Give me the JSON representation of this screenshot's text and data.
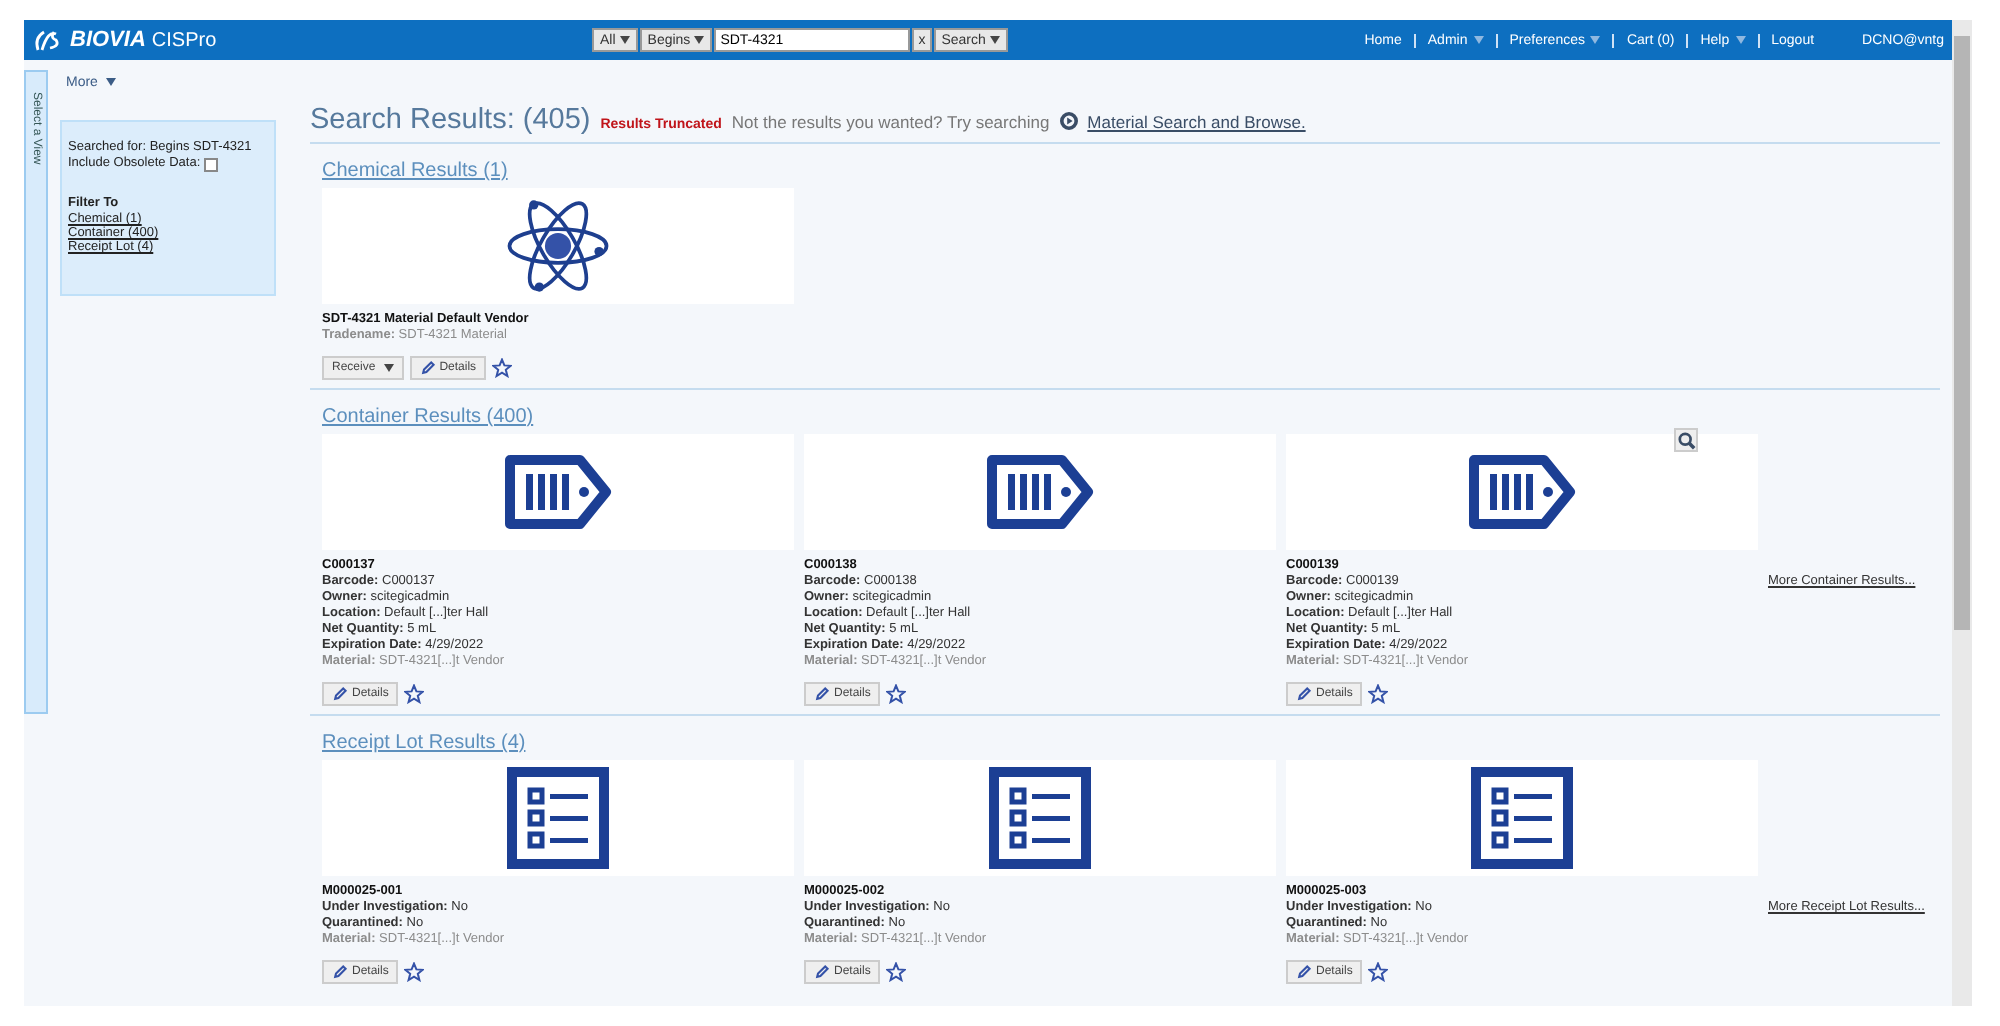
{
  "header": {
    "brand": "BIOVIA",
    "product": "CISPro",
    "search": {
      "scope": "All",
      "mode": "Begins",
      "value": "SDT-4321",
      "clear": "x",
      "button": "Search"
    },
    "nav": [
      {
        "label": "Home",
        "dropdown": false
      },
      {
        "label": "Admin",
        "dropdown": true
      },
      {
        "label": "Preferences",
        "dropdown": true
      },
      {
        "label": "Cart (0)",
        "dropdown": false
      },
      {
        "label": "Help",
        "dropdown": true
      },
      {
        "label": "Logout",
        "dropdown": false
      }
    ],
    "user": "DCNO@vntg"
  },
  "more_menu": "More",
  "side_tab": "Select a View",
  "filter_panel": {
    "searched_for": "Searched for: Begins SDT-4321",
    "include_obsolete": {
      "label": "Include Obsolete Data:",
      "checked": false
    },
    "filter_title": "Filter To",
    "filters": [
      {
        "label": "Chemical (1)"
      },
      {
        "label": "Container (400)"
      },
      {
        "label": "Receipt Lot (4)"
      }
    ]
  },
  "results": {
    "title": "Search Results:",
    "count": "(405)",
    "truncated": "Results Truncated",
    "hint": "Not the results you wanted? Try searching",
    "link": "Material Search and Browse."
  },
  "sections": [
    {
      "kind": "chemical",
      "title": "Chemical Results (1)",
      "items": [
        {
          "name": "SDT-4321 Material Default Vendor",
          "zoom_button": false,
          "fields": [
            {
              "label": "Tradename:",
              "value": "SDT-4321 Material",
              "muted": true
            }
          ],
          "buttons": [
            {
              "kind": "dropdown",
              "label": "Receive"
            },
            {
              "kind": "details",
              "label": "Details"
            }
          ]
        }
      ]
    },
    {
      "kind": "container",
      "title": "Container Results (400)",
      "more": "More Container Results...",
      "items": [
        {
          "name": "C000137",
          "zoom_button": false,
          "fields": [
            {
              "label": "Barcode:",
              "value": "C000137",
              "muted": false
            },
            {
              "label": "Owner:",
              "value": "scitegicadmin",
              "muted": false
            },
            {
              "label": "Location:",
              "value": "Default [...]ter Hall",
              "muted": false
            },
            {
              "label": "Net Quantity:",
              "value": "5 mL",
              "muted": false
            },
            {
              "label": "Expiration Date:",
              "value": "4/29/2022",
              "muted": false
            },
            {
              "label": "Material:",
              "value": "SDT-4321[...]t Vendor",
              "muted": true
            }
          ],
          "buttons": [
            {
              "kind": "details",
              "label": "Details"
            }
          ]
        },
        {
          "name": "C000138",
          "zoom_button": false,
          "fields": [
            {
              "label": "Barcode:",
              "value": "C000138",
              "muted": false
            },
            {
              "label": "Owner:",
              "value": "scitegicadmin",
              "muted": false
            },
            {
              "label": "Location:",
              "value": "Default [...]ter Hall",
              "muted": false
            },
            {
              "label": "Net Quantity:",
              "value": "5 mL",
              "muted": false
            },
            {
              "label": "Expiration Date:",
              "value": "4/29/2022",
              "muted": false
            },
            {
              "label": "Material:",
              "value": "SDT-4321[...]t Vendor",
              "muted": true
            }
          ],
          "buttons": [
            {
              "kind": "details",
              "label": "Details"
            }
          ]
        },
        {
          "name": "C000139",
          "zoom_button": true,
          "fields": [
            {
              "label": "Barcode:",
              "value": "C000139",
              "muted": false
            },
            {
              "label": "Owner:",
              "value": "scitegicadmin",
              "muted": false
            },
            {
              "label": "Location:",
              "value": "Default [...]ter Hall",
              "muted": false
            },
            {
              "label": "Net Quantity:",
              "value": "5 mL",
              "muted": false
            },
            {
              "label": "Expiration Date:",
              "value": "4/29/2022",
              "muted": false
            },
            {
              "label": "Material:",
              "value": "SDT-4321[...]t Vendor",
              "muted": true
            }
          ],
          "buttons": [
            {
              "kind": "details",
              "label": "Details"
            }
          ]
        }
      ]
    },
    {
      "kind": "receipt_lot",
      "title": "Receipt Lot Results (4)",
      "more": "More Receipt Lot Results...",
      "items": [
        {
          "name": "M000025-001",
          "zoom_button": false,
          "fields": [
            {
              "label": "Under Investigation:",
              "value": "No",
              "muted": false
            },
            {
              "label": "Quarantined:",
              "value": "No",
              "muted": false
            },
            {
              "label": "Material:",
              "value": "SDT-4321[...]t Vendor",
              "muted": true
            }
          ],
          "buttons": [
            {
              "kind": "details",
              "label": "Details"
            }
          ]
        },
        {
          "name": "M000025-002",
          "zoom_button": false,
          "fields": [
            {
              "label": "Under Investigation:",
              "value": "No",
              "muted": false
            },
            {
              "label": "Quarantined:",
              "value": "No",
              "muted": false
            },
            {
              "label": "Material:",
              "value": "SDT-4321[...]t Vendor",
              "muted": true
            }
          ],
          "buttons": [
            {
              "kind": "details",
              "label": "Details"
            }
          ]
        },
        {
          "name": "M000025-003",
          "zoom_button": false,
          "fields": [
            {
              "label": "Under Investigation:",
              "value": "No",
              "muted": false
            },
            {
              "label": "Quarantined:",
              "value": "No",
              "muted": false
            },
            {
              "label": "Material:",
              "value": "SDT-4321[...]t Vendor",
              "muted": true
            }
          ],
          "buttons": [
            {
              "kind": "details",
              "label": "Details"
            }
          ]
        }
      ]
    }
  ]
}
